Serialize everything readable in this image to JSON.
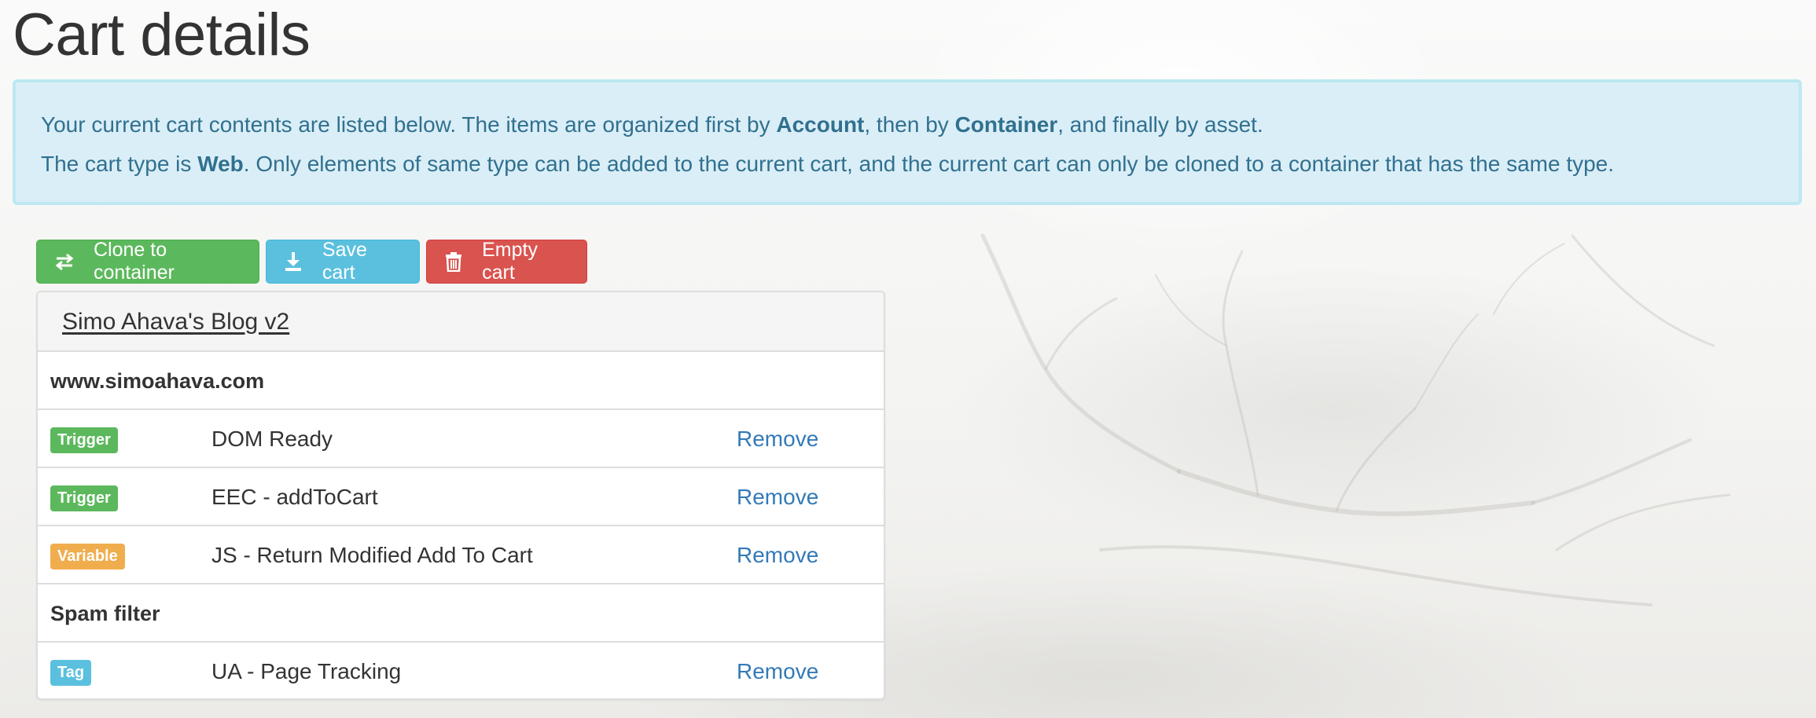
{
  "page": {
    "title": "Cart details"
  },
  "alert": {
    "line1": {
      "pre": "Your current cart contents are listed below. The items are organized first by ",
      "bold1": "Account",
      "mid": ", then by ",
      "bold2": "Container",
      "post": ", and finally by asset."
    },
    "line2": {
      "pre": "The cart type is ",
      "bold": "Web",
      "post": ". Only elements of same type can be added to the current cart, and the current cart can only be cloned to a container that has the same type."
    }
  },
  "toolbar": {
    "clone_label": "Clone to container",
    "clone_icon": "transfer-icon",
    "save_label": "Save cart",
    "save_icon": "download-icon",
    "empty_label": "Empty cart",
    "empty_icon": "trash-icon"
  },
  "account": {
    "name": "Simo Ahava's Blog v2",
    "containers": [
      {
        "name": "www.simoahava.com",
        "items": [
          {
            "type": "Trigger",
            "name": "DOM Ready",
            "action": "Remove"
          },
          {
            "type": "Trigger",
            "name": "EEC - addToCart",
            "action": "Remove"
          },
          {
            "type": "Variable",
            "name": "JS - Return Modified Add To Cart",
            "action": "Remove"
          }
        ]
      },
      {
        "name": "Spam filter",
        "items": [
          {
            "type": "Tag",
            "name": "UA - Page Tracking",
            "action": "Remove"
          }
        ]
      }
    ]
  },
  "colors": {
    "success": "#5cb85c",
    "info": "#5bc0de",
    "danger": "#d9534f",
    "warning": "#f0ad4e",
    "link": "#337ab7",
    "alert_bg": "#d9edf7",
    "alert_text": "#31708f"
  }
}
